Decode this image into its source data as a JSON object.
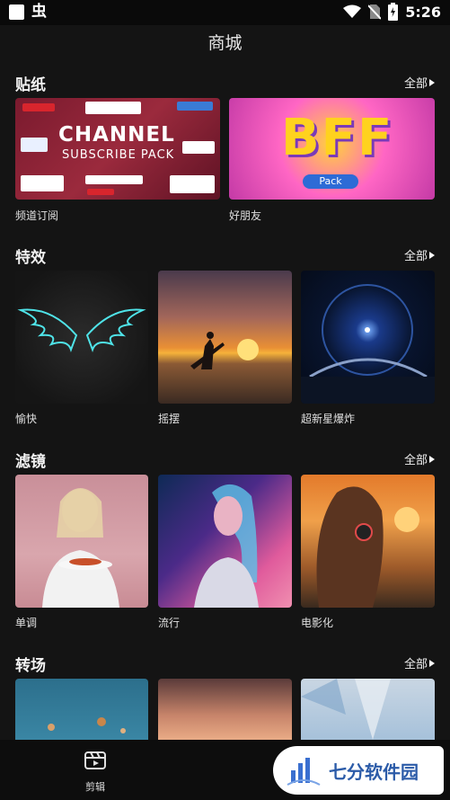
{
  "status_bar": {
    "time": "5:26",
    "app_icon": "bug-icon"
  },
  "page": {
    "title": "商城"
  },
  "sections": {
    "stickers": {
      "title": "贴纸",
      "all": "全部",
      "items": [
        "频道订阅",
        "好朋友"
      ],
      "thumb_text": {
        "channel": "CHANNEL",
        "subscribe_pack": "SUBSCRIBE PACK",
        "bff": "BFF",
        "pack": "Pack"
      }
    },
    "effects": {
      "title": "特效",
      "all": "全部",
      "items": [
        "愉快",
        "摇摆",
        "超新星爆炸"
      ]
    },
    "filters": {
      "title": "滤镜",
      "all": "全部",
      "items": [
        "单调",
        "流行",
        "电影化"
      ]
    },
    "transitions": {
      "title": "转场",
      "all": "全部"
    }
  },
  "bottom_nav": {
    "edit_label": "剪辑",
    "edit_icon": "film-clip-icon"
  },
  "watermark": {
    "text": "七分软件园"
  },
  "colors": {
    "background": "#141414",
    "watermark_blue": "#2b5ba8"
  }
}
